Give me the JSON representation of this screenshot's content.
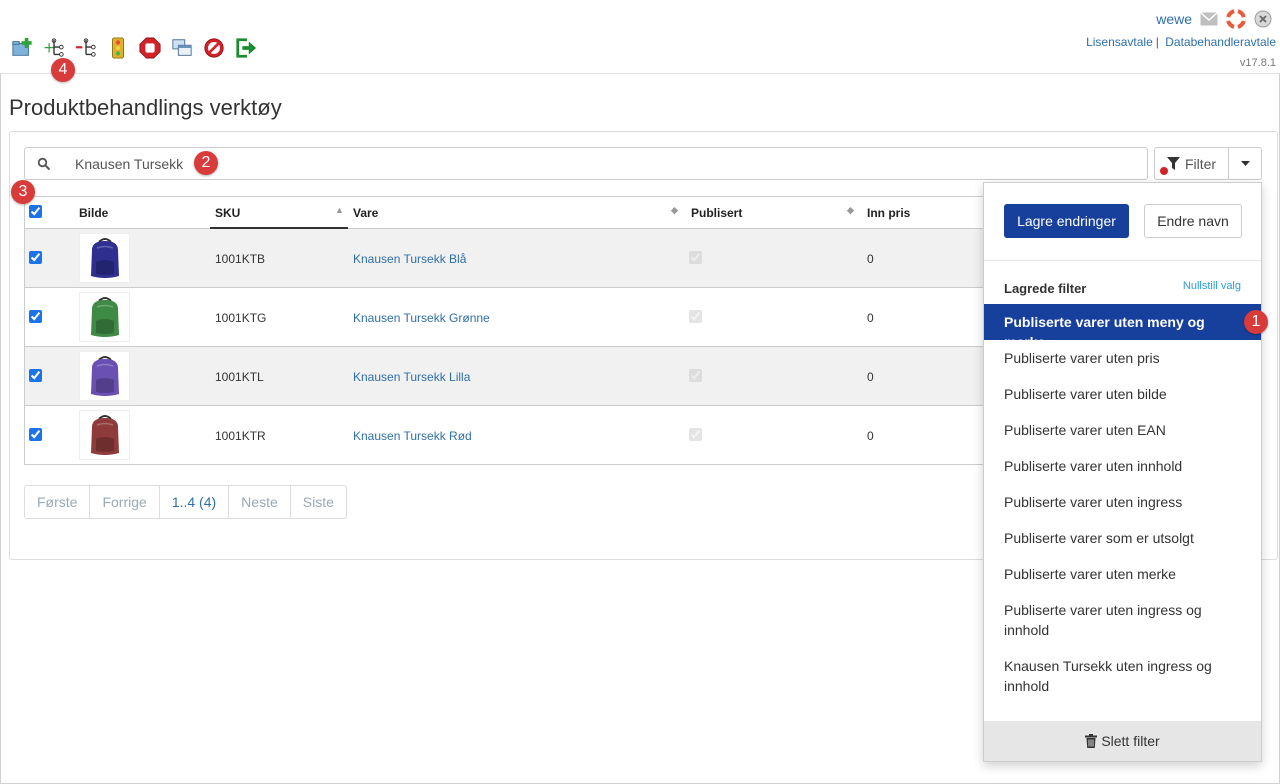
{
  "topbar": {
    "user_name": "wewe",
    "links": [
      "Lisensavtale",
      "Databehandleravtale"
    ],
    "link_separator": "|",
    "version": "v17.8.1",
    "toolbar_icons": [
      "add-folder-icon",
      "expand-tree-icon",
      "collapse-tree-icon",
      "traffic-light-icon",
      "stop-icon",
      "copy-windows-icon",
      "no-entry-icon",
      "exit-icon"
    ]
  },
  "page": {
    "title": "Produktbehandlings verktøy"
  },
  "search": {
    "value": "Knausen Tursekk",
    "placeholder": ""
  },
  "filter": {
    "label": "Filter"
  },
  "table": {
    "columns": [
      "Bilde",
      "SKU",
      "Vare",
      "Publisert",
      "Inn pris"
    ],
    "rows": [
      {
        "sku": "1001KTB",
        "vare": "Knausen Tursekk Blå",
        "price": "0",
        "color": "#2e2f8f"
      },
      {
        "sku": "1001KTG",
        "vare": "Knausen Tursekk Grønne",
        "price": "0",
        "color": "#3f8a44"
      },
      {
        "sku": "1001KTL",
        "vare": "Knausen Tursekk Lilla",
        "price": "0",
        "color": "#6a50b3"
      },
      {
        "sku": "1001KTR",
        "vare": "Knausen Tursekk Rød",
        "price": "0",
        "color": "#8f3b3b"
      }
    ]
  },
  "pager": [
    "Første",
    "Forrige",
    "1..4 (4)",
    "Neste",
    "Siste"
  ],
  "dropdown": {
    "save_label": "Lagre endringer",
    "rename_label": "Endre navn",
    "saved_heading": "Lagrede filter",
    "reset_label": "Nullstill valg",
    "items": [
      "Publiserte varer uten meny og merke",
      "Publiserte varer uten pris",
      "Publiserte varer uten bilde",
      "Publiserte varer uten EAN",
      "Publiserte varer uten innhold",
      "Publiserte varer uten ingress",
      "Publiserte varer som er utsolgt",
      "Publiserte varer uten merke",
      "Publiserte varer uten ingress og innhold",
      "Knausen Tursekk uten ingress og innhold"
    ],
    "delete_label": "Slett filter"
  },
  "markers": [
    "1",
    "2",
    "3",
    "4"
  ],
  "colors": {
    "accent": "#173f9c",
    "link": "#2f6fa8",
    "marker": "#d93a3a"
  }
}
